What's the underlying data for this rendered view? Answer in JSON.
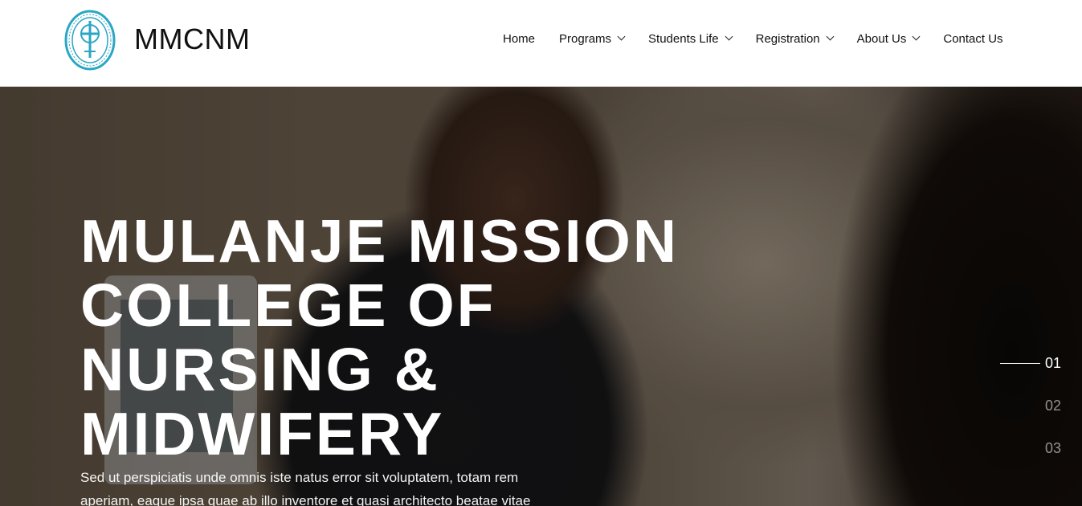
{
  "header": {
    "brand": "MMCNM",
    "logo_icon": "college-seal-logo",
    "nav": [
      {
        "label": "Home",
        "dropdown": false
      },
      {
        "label": "Programs",
        "dropdown": true
      },
      {
        "label": "Students Life",
        "dropdown": true
      },
      {
        "label": "Registration",
        "dropdown": true
      },
      {
        "label": "About Us",
        "dropdown": true
      },
      {
        "label": "Contact Us",
        "dropdown": false
      }
    ]
  },
  "hero": {
    "title_lines": [
      "MULANJE MISSION",
      "COLLEGE OF",
      "NURSING &",
      "MIDWIFERY"
    ],
    "subtitle": "Sed ut perspiciatis unde omnis iste natus error sit voluptatem, totam rem aperiam, eaque ipsa quae ab illo inventore et quasi architecto beatae vitae",
    "slides": [
      "01",
      "02",
      "03"
    ],
    "active_slide": "01"
  },
  "colors": {
    "logo": "#2aa6c4",
    "text_dark": "#111111",
    "hero_text": "#ffffff"
  }
}
